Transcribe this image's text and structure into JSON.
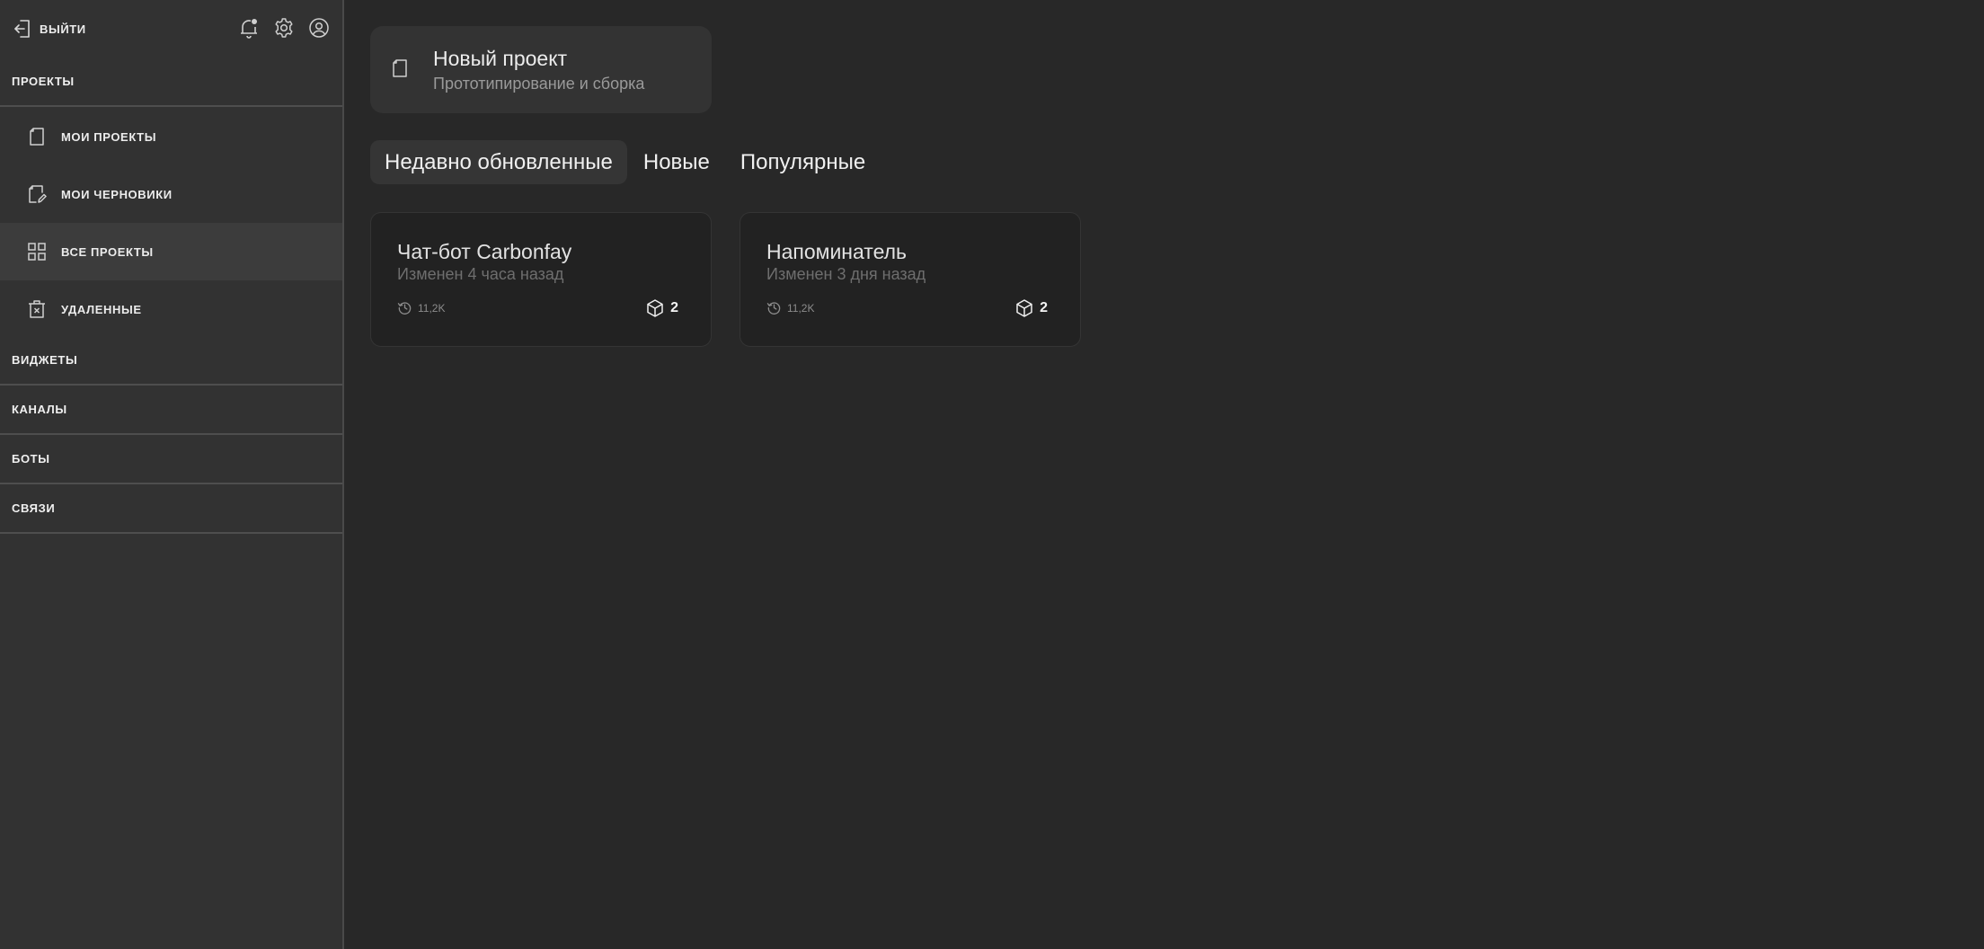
{
  "sidebar": {
    "logout_label": "ВЫЙТИ",
    "sections": {
      "projects": "ПРОЕКТЫ",
      "widgets": "ВИДЖЕТЫ",
      "channels": "КАНАЛЫ",
      "bots": "БОТЫ",
      "links": "СВЯЗИ"
    },
    "project_items": [
      {
        "label": "МОИ ПРОЕКТЫ",
        "icon": "document-icon"
      },
      {
        "label": "МОИ ЧЕРНОВИКИ",
        "icon": "draft-edit-icon"
      },
      {
        "label": "ВСЕ ПРОЕКТЫ",
        "icon": "grid-icon"
      },
      {
        "label": "УДАЛЕННЫЕ",
        "icon": "trash-icon"
      }
    ],
    "active_item": "ВСЕ ПРОЕКТЫ",
    "top_icons": [
      "notification-bell-icon",
      "settings-gear-icon",
      "user-profile-icon"
    ]
  },
  "new_project": {
    "title": "Новый проект",
    "subtitle": "Прототипирование и сборка"
  },
  "tabs": [
    {
      "label": "Недавно обновленные",
      "active": true
    },
    {
      "label": "Новые",
      "active": false
    },
    {
      "label": "Популярные",
      "active": false
    }
  ],
  "cards": [
    {
      "title": "Чат-бот Carbonfay",
      "subtitle": "Изменен 4 часа назад",
      "views": "11,2K",
      "count": "2"
    },
    {
      "title": "Напоминатель",
      "subtitle": "Изменен 3 дня назад",
      "views": "11,2K",
      "count": "2"
    }
  ],
  "colors": {
    "background": "#282828",
    "sidebar": "#323232",
    "sidebar_active": "#3c3c3c",
    "card": "#222222"
  }
}
